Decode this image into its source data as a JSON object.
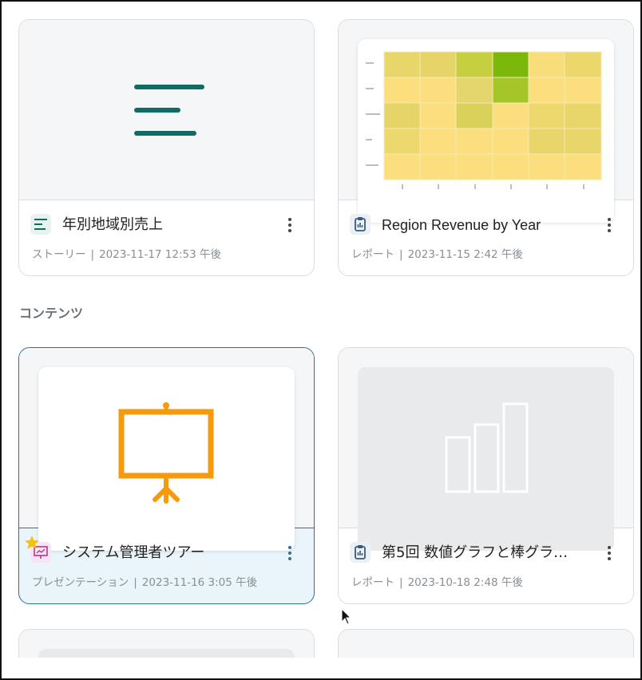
{
  "section": {
    "title": "コンテンツ"
  },
  "cards": [
    {
      "title": "年別地域別売上",
      "type_label": "ストーリー",
      "separator": "|",
      "timestamp": "2023-11-17 12:53 午後",
      "icon": "story-lines-icon",
      "thumbnail": "story-lines-icon"
    },
    {
      "title": "Region Revenue by Year",
      "type_label": "レポート",
      "separator": "|",
      "timestamp": "2023-11-15 2:42 午後",
      "icon": "report-clipboard-icon",
      "thumbnail": "heatmap-preview"
    },
    {
      "title": "システム管理者ツアー",
      "type_label": "プレゼンテーション",
      "separator": "|",
      "timestamp": "2023-11-16 3:05 午後",
      "icon": "presentation-icon",
      "favorite": true,
      "selected": true,
      "thumbnail": "easel-icon"
    },
    {
      "title": "第5回 数値グラフと棒グラ…",
      "type_label": "レポート",
      "separator": "|",
      "timestamp": "2023-10-18 2:48 午後",
      "icon": "report-clipboard-icon",
      "thumbnail": "bar-chart-placeholder-icon"
    }
  ],
  "colors": {
    "story_teal": "#0f6b63",
    "presentation_orange": "#f59a0c",
    "presentation_icon_magenta": "#b8329a",
    "report_icon_blue": "#3a5a78",
    "selected_border": "#2f6f9f",
    "favorite_star": "#f4c20d"
  }
}
